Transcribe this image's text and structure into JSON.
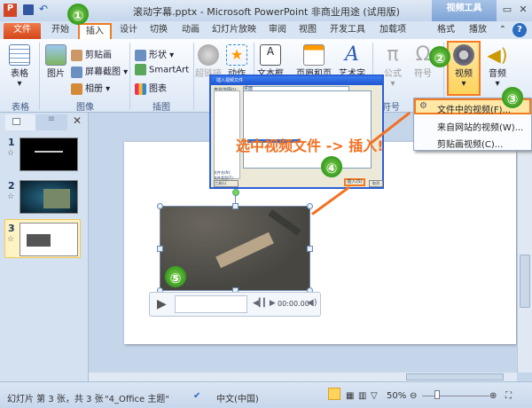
{
  "window": {
    "title": "滚动字幕.pptx - Microsoft PowerPoint 非商业用途 (试用版)",
    "context_tab": "视频工具"
  },
  "tabs": [
    "文件",
    "开始",
    "插入",
    "设计",
    "切换",
    "动画",
    "幻灯片放映",
    "审阅",
    "视图",
    "开发工具",
    "加载项",
    "格式",
    "播放"
  ],
  "ribbon": {
    "groups": [
      "表格",
      "图像",
      "插图",
      "符号"
    ],
    "table": "表格",
    "picture": "图片",
    "clipart": "剪贴画",
    "screenshot": "屏幕截图",
    "album": "相册",
    "shapes": "形状",
    "smartart": "SmartArt",
    "chart": "图表",
    "hyperlink": "超链接",
    "action": "动作",
    "textbox": "文本框",
    "header_footer": "页眉和页脚",
    "wordart": "艺术字",
    "equation": "公式",
    "symbol": "符号",
    "video": "视频",
    "audio": "音频"
  },
  "video_menu": {
    "items": [
      "文件中的视频(F)...",
      "来自网站的视频(W)...",
      "剪贴画视频(C)..."
    ]
  },
  "dialog": {
    "title": "插入视频文件",
    "location_label": "查找范围(I):",
    "location": "桌面",
    "filename_label": "文件名(N):",
    "filetype_label": "文件类型(T):",
    "insert": "插入(S)",
    "cancel": "取消",
    "tools": "工具(L)"
  },
  "annotation": "选中视频文件 -> 插入!",
  "badges": [
    "①",
    "②",
    "③",
    "④",
    "⑤"
  ],
  "slides": [
    {
      "num": "1"
    },
    {
      "num": "2"
    },
    {
      "num": "3",
      "selected": true
    }
  ],
  "player": {
    "time": "00:00.00"
  },
  "status": {
    "slide_info": "幻灯片 第 3 张，共 3 张",
    "theme": "\"4_Office 主题\"",
    "language": "中文(中国)",
    "zoom": "50%"
  },
  "colors": {
    "accent_orange": "#f47a20",
    "file_tab": "#d2461b",
    "badge_green": "#2e8f1b"
  }
}
